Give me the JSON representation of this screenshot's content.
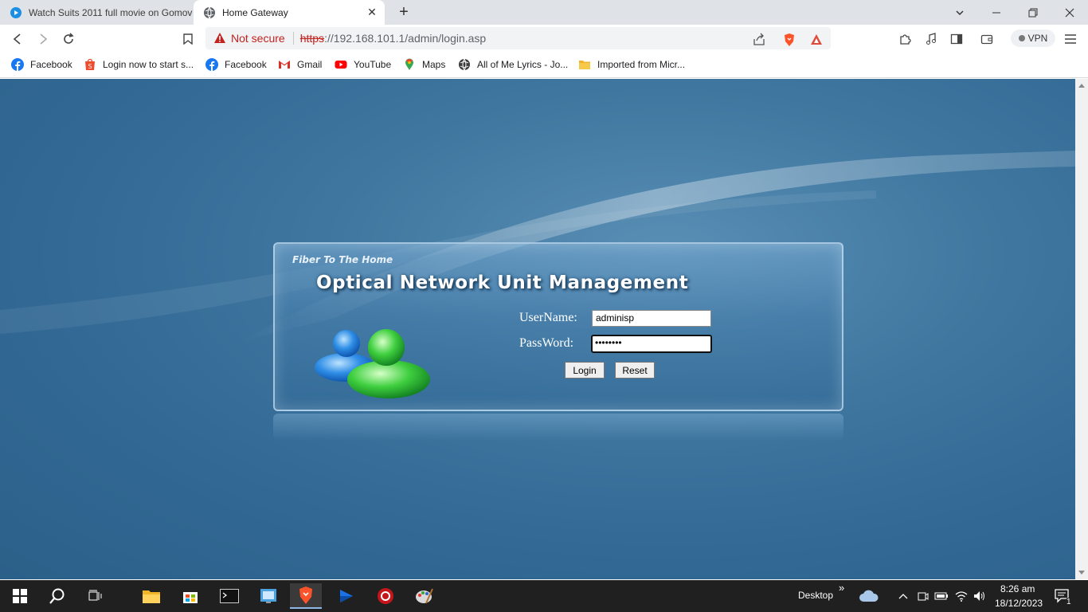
{
  "browser": {
    "tabs": [
      {
        "title": "Watch Suits 2011 full movie on Gomov",
        "active": false
      },
      {
        "title": "Home Gateway",
        "active": true
      }
    ],
    "new_tab_label": "+",
    "address": {
      "security_label": "Not secure",
      "url_scheme": "https",
      "url_rest": "://192.168.101.1/admin/login.asp"
    },
    "vpn_label": "VPN",
    "bookmarks": [
      {
        "label": "Facebook",
        "icon": "facebook-icon"
      },
      {
        "label": "Login now to start s...",
        "icon": "shop-icon"
      },
      {
        "label": "Facebook",
        "icon": "facebook-icon"
      },
      {
        "label": "Gmail",
        "icon": "gmail-icon"
      },
      {
        "label": "YouTube",
        "icon": "youtube-icon"
      },
      {
        "label": "Maps",
        "icon": "maps-icon"
      },
      {
        "label": "All of Me Lyrics - Jo...",
        "icon": "globe-icon"
      },
      {
        "label": "Imported from Micr...",
        "icon": "folder-icon"
      }
    ]
  },
  "login_page": {
    "subtitle": "Fiber To The Home",
    "title": "Optical Network Unit Management",
    "username_label": "UserName:",
    "username_value": "adminisp",
    "password_label": "PassWord:",
    "password_value": "••••••••",
    "login_button": "Login",
    "reset_button": "Reset"
  },
  "taskbar": {
    "desktop_label": "Desktop",
    "overflow_label": "»",
    "time": "8:26 am",
    "date": "18/12/2023",
    "notification_count": "1"
  },
  "colors": {
    "page_background": "#3a72a0",
    "accent": "#c5221f"
  }
}
